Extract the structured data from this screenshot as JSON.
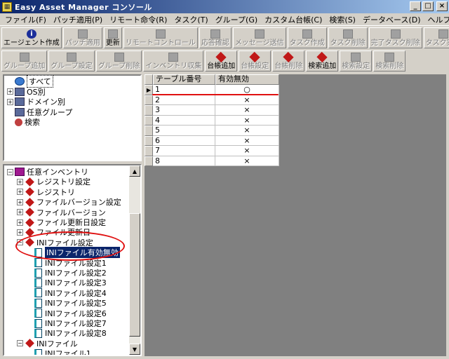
{
  "window": {
    "title": "Easy Asset Manager コンソール",
    "minimize": "_",
    "maximize": "□",
    "close": "×"
  },
  "menu": [
    "ファイル(F)",
    "パッチ適用(P)",
    "リモート命令(R)",
    "タスク(T)",
    "グループ(G)",
    "カスタム台帳(C)",
    "検索(S)",
    "データベース(D)",
    "ヘルプ(H)"
  ],
  "toolbar1": [
    {
      "label": "エージェント作成",
      "enabled": true,
      "icon": "info-icon"
    },
    {
      "label": "パッチ適用",
      "enabled": false,
      "icon": "patch-icon"
    },
    {
      "label": "更新",
      "enabled": true,
      "icon": "refresh-icon"
    },
    {
      "label": "リモートコントロール",
      "enabled": false,
      "icon": "remote-control-icon"
    },
    {
      "label": "応答確認",
      "enabled": false,
      "icon": "ping-icon"
    },
    {
      "label": "メッセージ送信",
      "enabled": false,
      "icon": "message-icon"
    },
    {
      "label": "タスク作成",
      "enabled": false,
      "icon": "task-create-icon"
    },
    {
      "label": "タスク削除",
      "enabled": false,
      "icon": "task-delete-icon"
    },
    {
      "label": "完了タスク削除",
      "enabled": false,
      "icon": "completed-task-delete-icon"
    },
    {
      "label": "タスク実行",
      "enabled": false,
      "icon": "task-run-icon"
    }
  ],
  "toolbar2": [
    {
      "label": "グループ追加",
      "enabled": false,
      "icon": "group-add-icon"
    },
    {
      "label": "グループ設定",
      "enabled": false,
      "icon": "group-settings-icon"
    },
    {
      "label": "グループ削除",
      "enabled": false,
      "icon": "group-delete-icon"
    },
    {
      "label": "インベントリ収集",
      "enabled": false,
      "icon": "inventory-collect-icon"
    },
    {
      "label": "台帳追加",
      "enabled": true,
      "icon": "ledger-add-icon"
    },
    {
      "label": "台帳設定",
      "enabled": false,
      "icon": "ledger-settings-icon"
    },
    {
      "label": "台帳削除",
      "enabled": false,
      "icon": "ledger-delete-icon"
    },
    {
      "label": "検索追加",
      "enabled": true,
      "icon": "search-add-icon"
    },
    {
      "label": "検索設定",
      "enabled": false,
      "icon": "search-settings-icon"
    },
    {
      "label": "検索削除",
      "enabled": false,
      "icon": "search-delete-icon"
    }
  ],
  "tree_top": [
    {
      "label": "すべて",
      "icon": "globe-icon",
      "level": 0,
      "expander": "",
      "selected": true
    },
    {
      "label": "OS別",
      "icon": "computer-icon",
      "level": 0,
      "expander": "+"
    },
    {
      "label": "ドメイン別",
      "icon": "computer-icon",
      "level": 0,
      "expander": "+"
    },
    {
      "label": "任意グループ",
      "icon": "computer-icon",
      "level": 0,
      "expander": ""
    },
    {
      "label": "検索",
      "icon": "search-icon",
      "level": 0,
      "expander": ""
    }
  ],
  "tree_bottom": [
    {
      "label": "任意インベントリ",
      "icon": "book-icon",
      "level": 0,
      "expander": "−"
    },
    {
      "label": "レジストリ設定",
      "icon": "diamond-icon",
      "level": 1,
      "expander": "+"
    },
    {
      "label": "レジストリ",
      "icon": "diamond-icon",
      "level": 1,
      "expander": "+"
    },
    {
      "label": "ファイルバージョン設定",
      "icon": "diamond-icon",
      "level": 1,
      "expander": "+"
    },
    {
      "label": "ファイルバージョン",
      "icon": "diamond-icon",
      "level": 1,
      "expander": "+"
    },
    {
      "label": "ファイル更新日設定",
      "icon": "diamond-icon",
      "level": 1,
      "expander": "+"
    },
    {
      "label": "ファイル更新日",
      "icon": "diamond-icon",
      "level": 1,
      "expander": "+"
    },
    {
      "label": "INIファイル設定",
      "icon": "diamond-icon",
      "level": 1,
      "expander": "−"
    },
    {
      "label": "INIファイル有効無効",
      "icon": "document-icon",
      "level": 2,
      "expander": "",
      "selected": true
    },
    {
      "label": "INIファイル設定1",
      "icon": "document-icon",
      "level": 2,
      "expander": ""
    },
    {
      "label": "INIファイル設定2",
      "icon": "document-icon",
      "level": 2,
      "expander": ""
    },
    {
      "label": "INIファイル設定3",
      "icon": "document-icon",
      "level": 2,
      "expander": ""
    },
    {
      "label": "INIファイル設定4",
      "icon": "document-icon",
      "level": 2,
      "expander": ""
    },
    {
      "label": "INIファイル設定5",
      "icon": "document-icon",
      "level": 2,
      "expander": ""
    },
    {
      "label": "INIファイル設定6",
      "icon": "document-icon",
      "level": 2,
      "expander": ""
    },
    {
      "label": "INIファイル設定7",
      "icon": "document-icon",
      "level": 2,
      "expander": ""
    },
    {
      "label": "INIファイル設定8",
      "icon": "document-icon",
      "level": 2,
      "expander": ""
    },
    {
      "label": "INIファイル",
      "icon": "diamond-icon",
      "level": 1,
      "expander": "−"
    },
    {
      "label": "INIファイル1",
      "icon": "document-icon",
      "level": 2,
      "expander": ""
    }
  ],
  "grid": {
    "headers": [
      "テーブル番号",
      "有効無効"
    ],
    "rows": [
      [
        "1",
        "○"
      ],
      [
        "2",
        "×"
      ],
      [
        "3",
        "×"
      ],
      [
        "4",
        "×"
      ],
      [
        "5",
        "×"
      ],
      [
        "6",
        "×"
      ],
      [
        "7",
        "×"
      ],
      [
        "8",
        "×"
      ]
    ],
    "current_row": 0,
    "row_pointer": "▶"
  },
  "scrollbar": {
    "up": "▲",
    "down": "▼"
  },
  "colors": {
    "annotation": "#e01010",
    "selection": "#0a246a",
    "titlebar_start": "#0a246a",
    "titlebar_end": "#a6caf0"
  }
}
